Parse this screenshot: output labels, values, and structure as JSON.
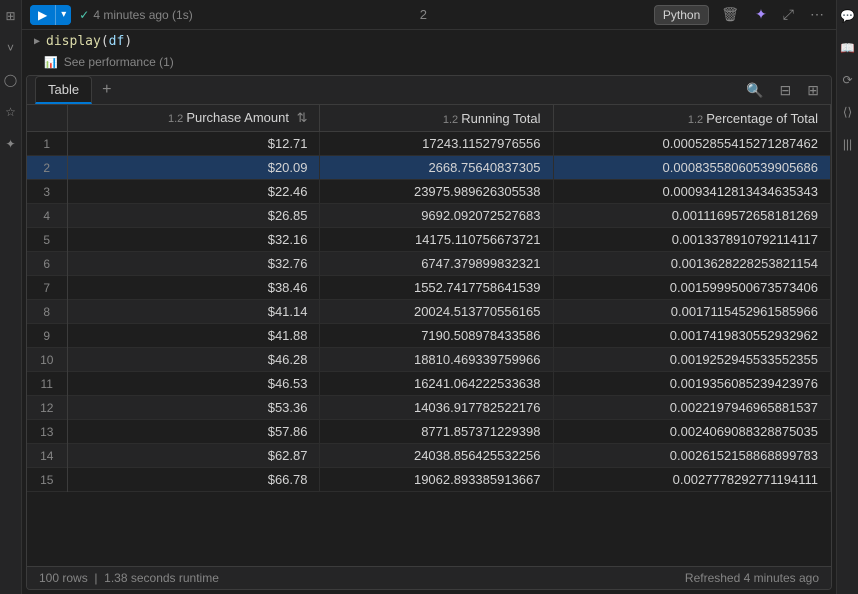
{
  "sidebar_left": {
    "icons": [
      "grid-icon",
      "chevron-down-icon",
      "person-icon",
      "star-icon",
      "sparkle-icon"
    ]
  },
  "sidebar_right": {
    "icons": [
      "chat-icon",
      "book-icon",
      "history-icon",
      "code-icon",
      "library-icon"
    ]
  },
  "cell": {
    "run_button_label": "▶",
    "run_status": "4 minutes ago (1s)",
    "cell_number": "2",
    "python_badge": "Python",
    "code_line": "display(df)",
    "perf_line": "See performance (1)"
  },
  "toolbar": {
    "delete_icon": "🗑",
    "sparkle_icon": "✦",
    "expand_icon": "⤢",
    "more_icon": "⋯"
  },
  "table_tab": {
    "label": "Table",
    "add_label": "+",
    "search_icon": "🔍",
    "filter_icon": "⊟",
    "layout_icon": "⊞"
  },
  "table": {
    "columns": [
      {
        "name": "",
        "type": ""
      },
      {
        "name": "Purchase Amount",
        "type": "1.2"
      },
      {
        "name": "Running Total",
        "type": "1.2"
      },
      {
        "name": "Percentage of Total",
        "type": "1.2"
      }
    ],
    "rows": [
      {
        "index": 1,
        "purchase_amount": "$12.71",
        "running_total": "17243.11527976556",
        "percentage": "0.00052855415271287462"
      },
      {
        "index": 2,
        "purchase_amount": "$20.09",
        "running_total": "2668.75640837305",
        "percentage": "0.00083558060539905686"
      },
      {
        "index": 3,
        "purchase_amount": "$22.46",
        "running_total": "23975.989626305538",
        "percentage": "0.00093412813434635343"
      },
      {
        "index": 4,
        "purchase_amount": "$26.85",
        "running_total": "9692.092072527683",
        "percentage": "0.0011169572658181269"
      },
      {
        "index": 5,
        "purchase_amount": "$32.16",
        "running_total": "14175.110756673721",
        "percentage": "0.0013378910792114117"
      },
      {
        "index": 6,
        "purchase_amount": "$32.76",
        "running_total": "6747.379899832321",
        "percentage": "0.0013628228253821154"
      },
      {
        "index": 7,
        "purchase_amount": "$38.46",
        "running_total": "1552.7417758641539",
        "percentage": "0.0015999500673573406"
      },
      {
        "index": 8,
        "purchase_amount": "$41.14",
        "running_total": "20024.513770556165",
        "percentage": "0.0017115452961585966"
      },
      {
        "index": 9,
        "purchase_amount": "$41.88",
        "running_total": "7190.508978433586",
        "percentage": "0.0017419830552932962"
      },
      {
        "index": 10,
        "purchase_amount": "$46.28",
        "running_total": "18810.469339759966",
        "percentage": "0.0019252945533552355"
      },
      {
        "index": 11,
        "purchase_amount": "$46.53",
        "running_total": "16241.064222533638",
        "percentage": "0.0019356085239423976"
      },
      {
        "index": 12,
        "purchase_amount": "$53.36",
        "running_total": "14036.917782522176",
        "percentage": "0.0022197946965881537"
      },
      {
        "index": 13,
        "purchase_amount": "$57.86",
        "running_total": "8771.857371229398",
        "percentage": "0.0024069088328875035"
      },
      {
        "index": 14,
        "purchase_amount": "$62.87",
        "running_total": "24038.856425532256",
        "percentage": "0.0026152158868899783"
      },
      {
        "index": 15,
        "purchase_amount": "$66.78",
        "running_total": "19062.893385913667",
        "percentage": "0.0027778292771194111"
      }
    ]
  },
  "footer": {
    "row_count": "100 rows",
    "runtime": "1.38 seconds runtime",
    "refresh_status": "Refreshed 4 minutes ago"
  }
}
